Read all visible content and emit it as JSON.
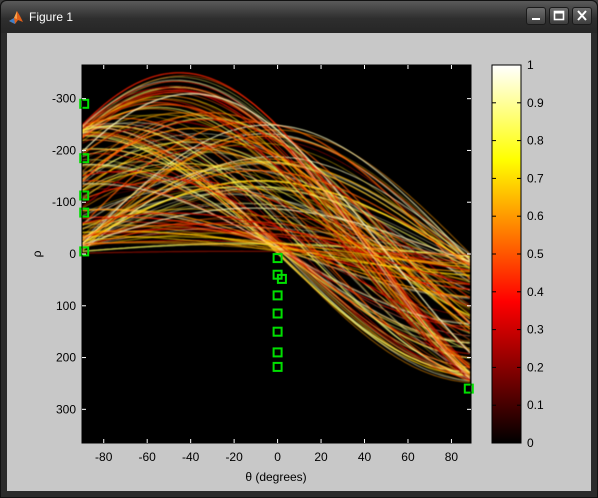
{
  "window": {
    "title": "Figure 1",
    "minimize_icon": "minimize-icon",
    "maximize_icon": "maximize-icon",
    "close_icon": "close-icon"
  },
  "chart_data": {
    "type": "heatmap",
    "title": "",
    "xlabel": "θ (degrees)",
    "ylabel": "ρ",
    "xlim": [
      -90,
      89
    ],
    "ylim": [
      -365,
      365
    ],
    "y_reversed": true,
    "x_ticks": [
      -80,
      -60,
      -40,
      -20,
      0,
      20,
      40,
      60,
      80
    ],
    "y_ticks": [
      -300,
      -200,
      -100,
      0,
      100,
      200,
      300
    ],
    "colormap": "hot",
    "colorbar": {
      "ticks": [
        0,
        0.1,
        0.2,
        0.3,
        0.4,
        0.5,
        0.6,
        0.7,
        0.8,
        0.9,
        1
      ],
      "labels": [
        "0",
        "0.1",
        "0.2",
        "0.3",
        "0.4",
        "0.5",
        "0.6",
        "0.7",
        "0.8",
        "0.9",
        "1"
      ]
    },
    "peak_marker_color": "#00e000",
    "peaks": [
      {
        "theta": -89,
        "rho": -290
      },
      {
        "theta": -89,
        "rho": -185
      },
      {
        "theta": -89,
        "rho": -113
      },
      {
        "theta": -89,
        "rho": -80
      },
      {
        "theta": -89,
        "rho": -5
      },
      {
        "theta": 0,
        "rho": 8
      },
      {
        "theta": 0,
        "rho": 40
      },
      {
        "theta": 2,
        "rho": 48
      },
      {
        "theta": 0,
        "rho": 80
      },
      {
        "theta": 0,
        "rho": 115
      },
      {
        "theta": 0,
        "rho": 150
      },
      {
        "theta": 0,
        "rho": 190
      },
      {
        "theta": 0,
        "rho": 218
      },
      {
        "theta": 88,
        "rho": 260
      }
    ]
  }
}
